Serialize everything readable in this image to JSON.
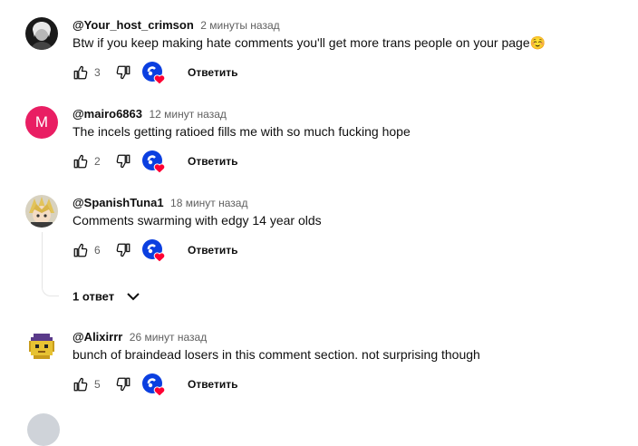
{
  "comments": [
    {
      "author": "@Your_host_crimson",
      "time": "2 минуты назад",
      "text": "Btw if you keep making hate comments you'll get more trans people on your page☺️",
      "likes": "3",
      "reply_label": "Ответить",
      "avatar_icon": "dark-portrait-avatar"
    },
    {
      "author": "@mairo6863",
      "time": "12 минут назад",
      "text": "The incels getting ratioed fills me with so much fucking hope",
      "likes": "2",
      "reply_label": "Ответить",
      "avatar_letter": "M",
      "avatar_color": "#e91e63"
    },
    {
      "author": "@SpanishTuna1",
      "time": "18 минут назад",
      "text": "Comments swarming with edgy 14 year olds",
      "likes": "6",
      "reply_label": "Ответить",
      "avatar_icon": "anime-character-avatar",
      "replies_label": "1 ответ"
    },
    {
      "author": "@Alixirrr",
      "time": "26 минут назад",
      "text": "bunch of braindead losers in this comment section. not surprising though",
      "likes": "5",
      "reply_label": "Ответить",
      "avatar_icon": "pixel-art-avatar"
    }
  ],
  "colors": {
    "accent_blue": "#0b3fe0",
    "heart_red": "#ff0033",
    "meta_gray": "#606060"
  }
}
